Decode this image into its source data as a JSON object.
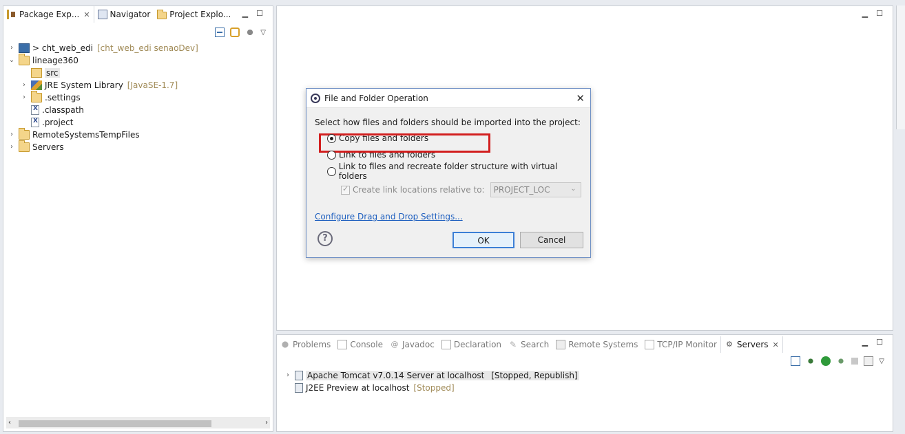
{
  "left_panel": {
    "tabs": [
      {
        "label": "Package Exp...",
        "active": true,
        "closable": true
      },
      {
        "label": "Navigator",
        "active": false
      },
      {
        "label": "Project Explo...",
        "active": false
      }
    ],
    "tree": [
      {
        "label": "> cht_web_edi",
        "decoration": "[cht_web_edi senaoDev]",
        "expanded": false,
        "depth": 0,
        "icon": "web-project-icon"
      },
      {
        "label": "lineage360",
        "decoration": "",
        "expanded": true,
        "depth": 0,
        "icon": "project-folder-icon"
      },
      {
        "label": "src",
        "decoration": "",
        "depth": 1,
        "icon": "source-folder-icon",
        "selected": true
      },
      {
        "label": "JRE System Library",
        "decoration": "[JavaSE-1.7]",
        "expanded": false,
        "depth": 1,
        "icon": "library-icon"
      },
      {
        "label": ".settings",
        "decoration": "",
        "expanded": false,
        "depth": 1,
        "icon": "folder-icon"
      },
      {
        "label": ".classpath",
        "decoration": "",
        "depth": 1,
        "icon": "xml-file-icon"
      },
      {
        "label": ".project",
        "decoration": "",
        "depth": 1,
        "icon": "xml-file-icon"
      },
      {
        "label": "RemoteSystemsTempFiles",
        "decoration": "",
        "expanded": false,
        "depth": 0,
        "icon": "project-folder-icon"
      },
      {
        "label": "Servers",
        "decoration": "",
        "expanded": false,
        "depth": 0,
        "icon": "project-folder-icon"
      }
    ]
  },
  "dialog": {
    "title": "File and Folder Operation",
    "prompt": "Select how files and folders should be imported into the project:",
    "options": [
      {
        "label": "Copy files and folders",
        "selected": true
      },
      {
        "label": "Link to files and folders",
        "selected": false
      },
      {
        "label": "Link to files and recreate folder structure with virtual folders",
        "selected": false
      }
    ],
    "relative_checkbox_label": "Create link locations relative to:",
    "relative_combo_value": "PROJECT_LOC",
    "configure_link": "Configure Drag and Drop Settings...",
    "help_symbol": "?",
    "ok_label": "OK",
    "cancel_label": "Cancel",
    "highlight_color": "#d21e1e"
  },
  "bottom_panel": {
    "tabs": [
      {
        "label": "Problems",
        "active": false
      },
      {
        "label": "Console",
        "active": false
      },
      {
        "label": "Javadoc",
        "active": false
      },
      {
        "label": "Declaration",
        "active": false
      },
      {
        "label": "Search",
        "active": false
      },
      {
        "label": "Remote Systems",
        "active": false
      },
      {
        "label": "TCP/IP Monitor",
        "active": false
      },
      {
        "label": "Servers",
        "active": true,
        "closable": true
      }
    ],
    "servers": [
      {
        "label": "Apache Tomcat v7.0.14 Server at localhost",
        "status": "[Stopped, Republish]",
        "selected": true
      },
      {
        "label": "J2EE Preview at localhost",
        "status": "[Stopped]",
        "selected": false
      }
    ]
  }
}
